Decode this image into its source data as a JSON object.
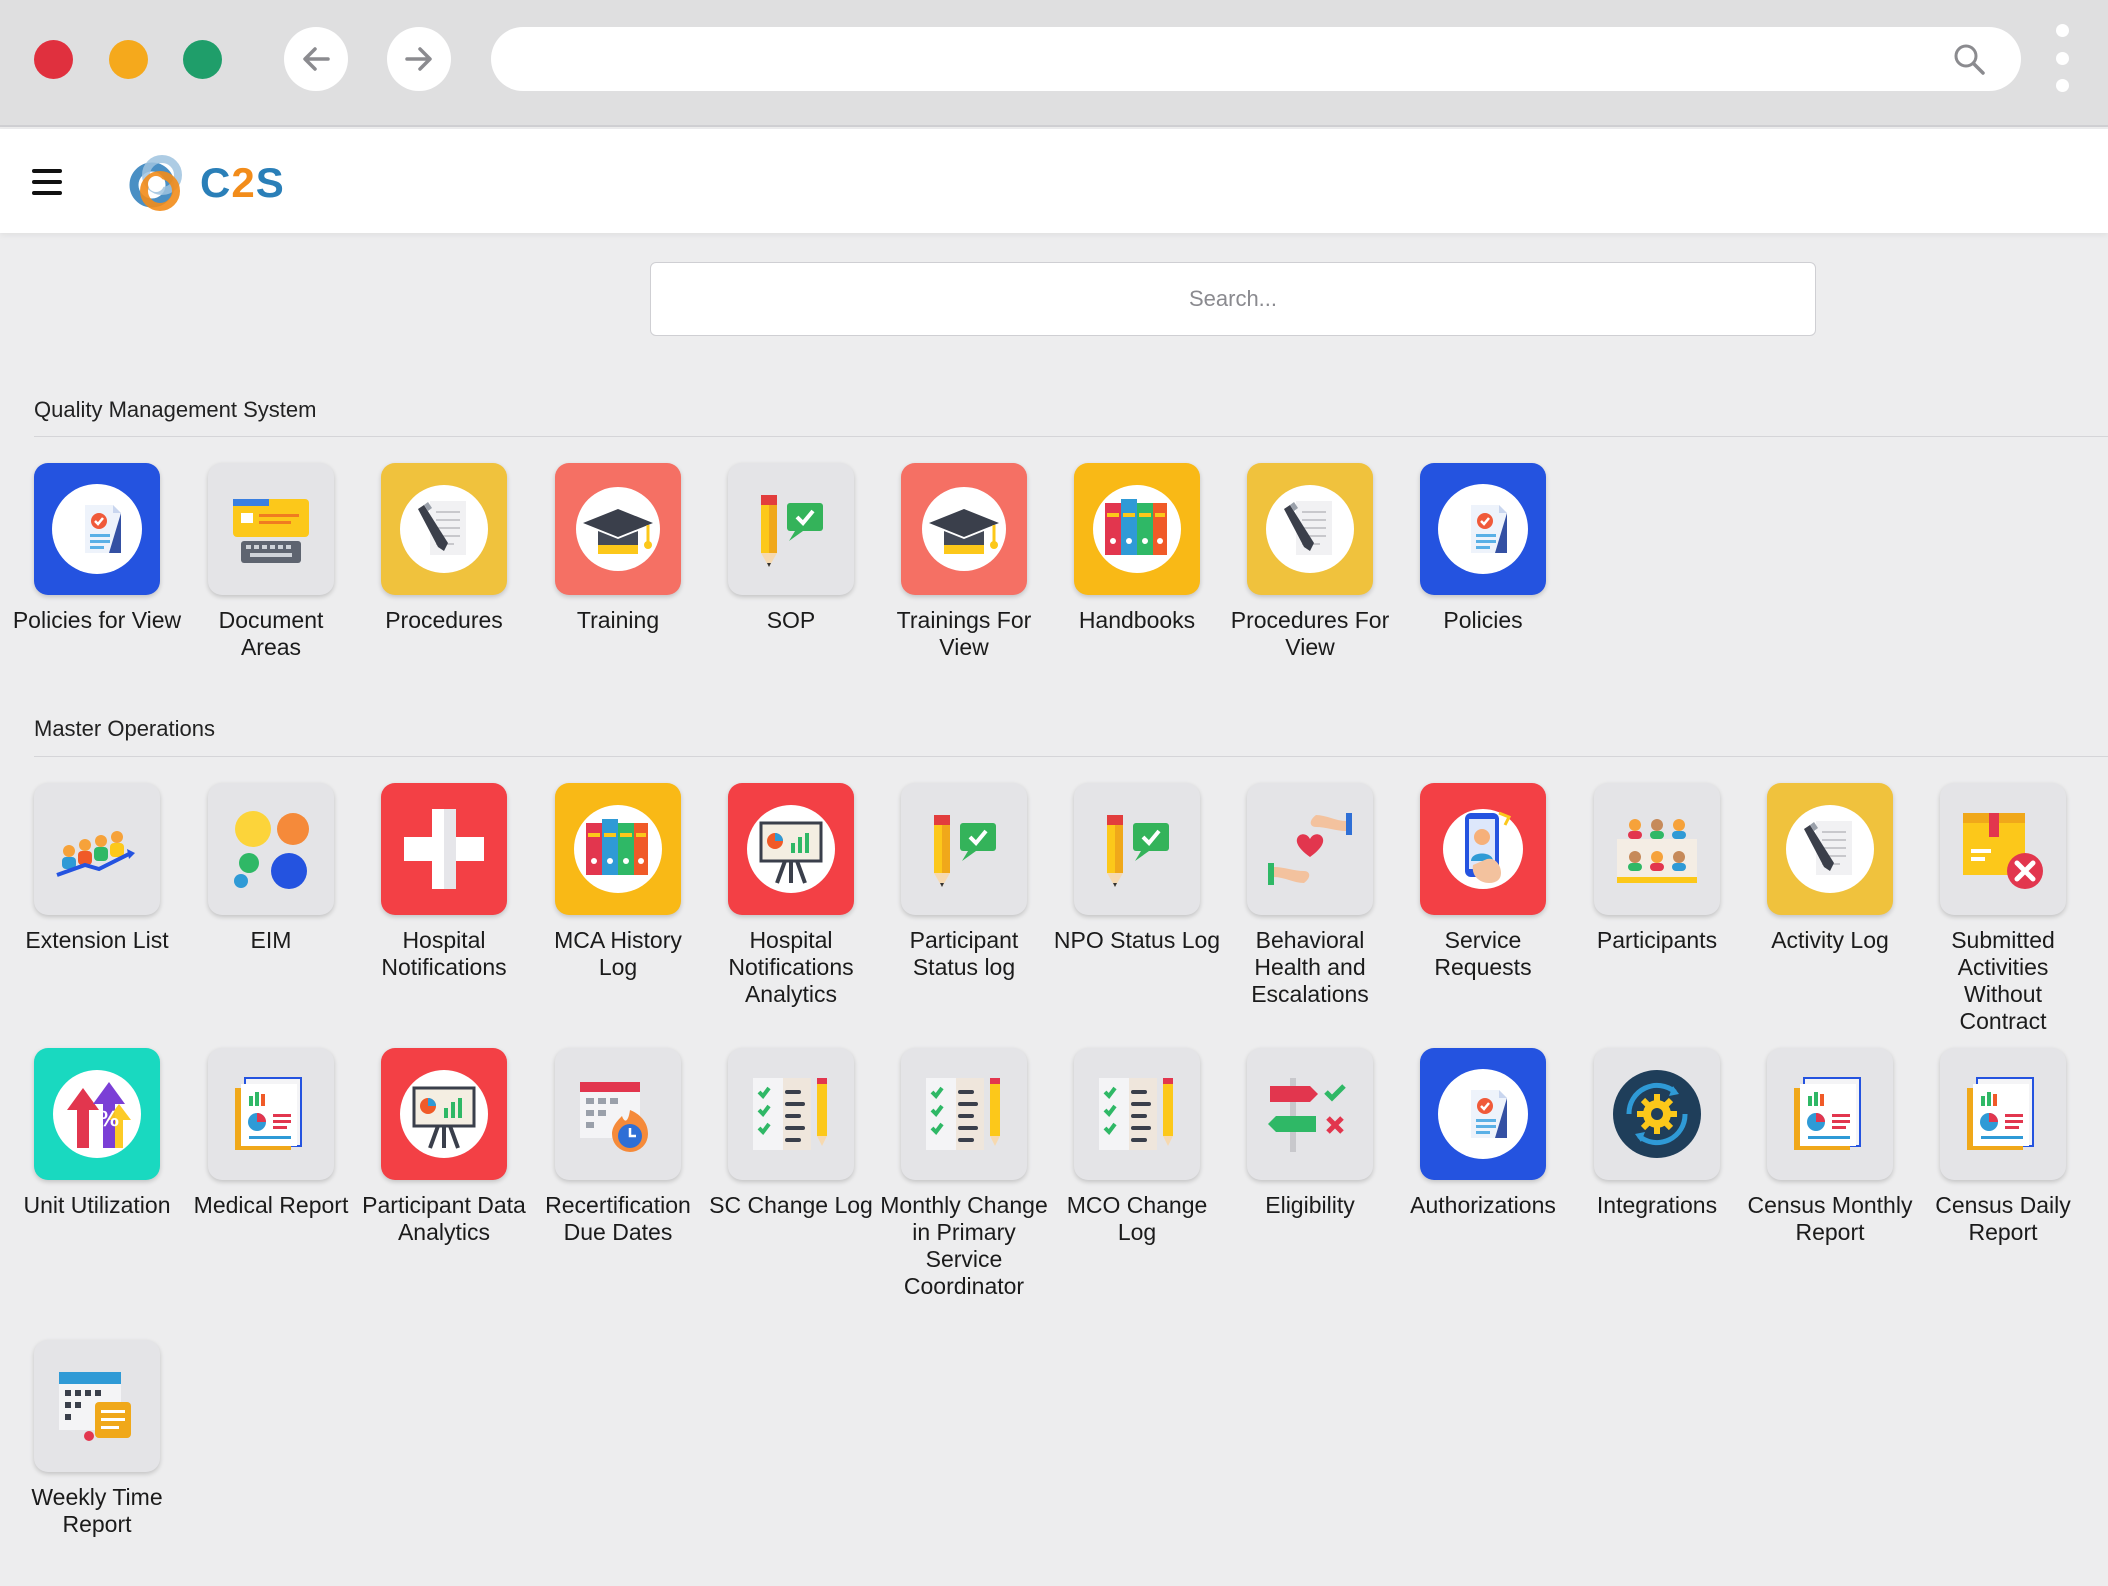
{
  "search": {
    "placeholder": "Search..."
  },
  "brand": {
    "logo_text_c": "C",
    "logo_text_2": "2",
    "logo_text_s": "S"
  },
  "sections": {
    "qms": {
      "title": "Quality Management System",
      "tiles": [
        {
          "label": "Policies for View",
          "icon": "policy-document-icon",
          "bg": "#2453e0"
        },
        {
          "label": "Document Areas",
          "icon": "document-keyboard-icon",
          "bg": "#e4e4e7"
        },
        {
          "label": "Procedures",
          "icon": "notepad-pen-icon",
          "bg": "#f0c23d"
        },
        {
          "label": "Training",
          "icon": "graduation-cap-icon",
          "bg": "#f57064"
        },
        {
          "label": "SOP",
          "icon": "pencil-chat-icon",
          "bg": "#e4e4e7"
        },
        {
          "label": "Trainings For View",
          "icon": "graduation-cap-icon",
          "bg": "#f57064"
        },
        {
          "label": "Handbooks",
          "icon": "binders-icon",
          "bg": "#f9b916"
        },
        {
          "label": "Procedures For View",
          "icon": "notepad-pen-icon",
          "bg": "#f0c23d"
        },
        {
          "label": "Policies",
          "icon": "policy-document-icon",
          "bg": "#2453e0"
        }
      ]
    },
    "master": {
      "title": "Master Operations",
      "tiles": [
        {
          "label": "Extension List",
          "icon": "people-growth-icon",
          "bg": "#e4e4e7"
        },
        {
          "label": "EIM",
          "icon": "colored-circles-icon",
          "bg": "#e4e4e7"
        },
        {
          "label": "Hospital Notifications",
          "icon": "medical-cross-icon",
          "bg": "#f34045"
        },
        {
          "label": "MCA History Log",
          "icon": "binders-icon",
          "bg": "#f9b916"
        },
        {
          "label": "Hospital Notifications Analytics",
          "icon": "presentation-board-icon",
          "bg": "#f34045"
        },
        {
          "label": "Participant Status log",
          "icon": "pencil-chat-icon",
          "bg": "#e4e4e7"
        },
        {
          "label": "NPO Status Log",
          "icon": "pencil-chat-icon",
          "bg": "#e4e4e7"
        },
        {
          "label": "Behavioral Health and Escalations",
          "icon": "hands-heart-icon",
          "bg": "#e4e4e7"
        },
        {
          "label": "Service Requests",
          "icon": "phone-support-icon",
          "bg": "#f34045"
        },
        {
          "label": "Participants",
          "icon": "group-icon",
          "bg": "#e4e4e7"
        },
        {
          "label": "Activity Log",
          "icon": "notepad-pen-icon",
          "bg": "#f0c23d"
        },
        {
          "label": "Submitted Activities Without Contract",
          "icon": "box-cancel-icon",
          "bg": "#e4e4e7"
        },
        {
          "label": "Unit Utilization",
          "icon": "percentage-arrows-icon",
          "bg": "#19d9c0"
        },
        {
          "label": "Medical Report",
          "icon": "report-charts-icon",
          "bg": "#e4e4e7"
        },
        {
          "label": "Participant Data Analytics",
          "icon": "presentation-board-icon",
          "bg": "#f34045"
        },
        {
          "label": "Recertification Due Dates",
          "icon": "calendar-clock-icon",
          "bg": "#e4e4e7"
        },
        {
          "label": "SC Change Log",
          "icon": "checklist-pencil-icon",
          "bg": "#e4e4e7"
        },
        {
          "label": "Monthly Change in Primary Service Coordinator",
          "icon": "checklist-pencil-icon",
          "bg": "#e4e4e7"
        },
        {
          "label": "MCO Change Log",
          "icon": "checklist-pencil-icon",
          "bg": "#e4e4e7"
        },
        {
          "label": "Eligibility",
          "icon": "signpost-check-icon",
          "bg": "#e4e4e7"
        },
        {
          "label": "Authorizations",
          "icon": "policy-document-icon",
          "bg": "#2453e0"
        },
        {
          "label": "Integrations",
          "icon": "gear-sync-icon",
          "bg": "#e4e4e7"
        },
        {
          "label": "Census Monthly Report",
          "icon": "report-charts-icon",
          "bg": "#e4e4e7"
        },
        {
          "label": "Census Daily Report",
          "icon": "report-charts-icon",
          "bg": "#e4e4e7"
        },
        {
          "label": "Weekly Time Report",
          "icon": "calendar-notes-icon",
          "bg": "#e4e4e7"
        }
      ]
    }
  }
}
